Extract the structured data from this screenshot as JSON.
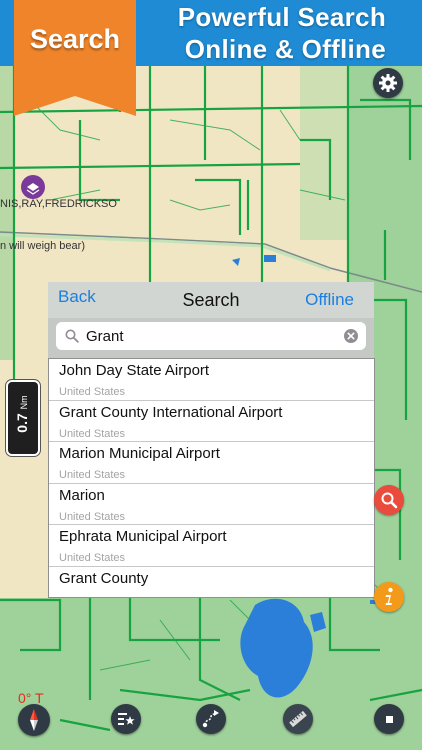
{
  "header": {
    "badge_label": "Search",
    "line1": "Powerful Search",
    "line2": "Online & Offline"
  },
  "map": {
    "place_label": "NIS,RAY,FREDRICKSO",
    "note_label": "n will weigh bear)",
    "scale_text": "0.7",
    "scale_unit": "Nm",
    "heading_label": "0° T"
  },
  "search_panel": {
    "back_label": "Back",
    "title": "Search",
    "offline_label": "Offline",
    "query_value": "Grant"
  },
  "results": [
    {
      "name": "John Day State Airport",
      "country": "United States"
    },
    {
      "name": "Grant County International Airport",
      "country": "United States"
    },
    {
      "name": "Marion Municipal Airport",
      "country": "United States"
    },
    {
      "name": "Marion",
      "country": "United States"
    },
    {
      "name": "Ephrata Municipal Airport",
      "country": "United States"
    },
    {
      "name": "Grant County",
      "country": ""
    }
  ],
  "icons": {
    "settings": "gear-icon",
    "layers": "layers-icon",
    "search": "magnifier-icon",
    "info": "info-icon",
    "compass": "compass-icon",
    "favorites": "star-list-icon",
    "route": "route-icon",
    "measure": "ruler-icon",
    "stop": "stop-icon"
  },
  "colors": {
    "banner": "#1e8bd4",
    "badge": "#f0842a",
    "map_land": "#f1e6c4",
    "map_green": "#9fd19a",
    "roads": "#17a341",
    "water": "#2b7fd9",
    "link_blue": "#1a7fe0",
    "search_red": "#e94b3c",
    "info_orange": "#f39a1a"
  }
}
